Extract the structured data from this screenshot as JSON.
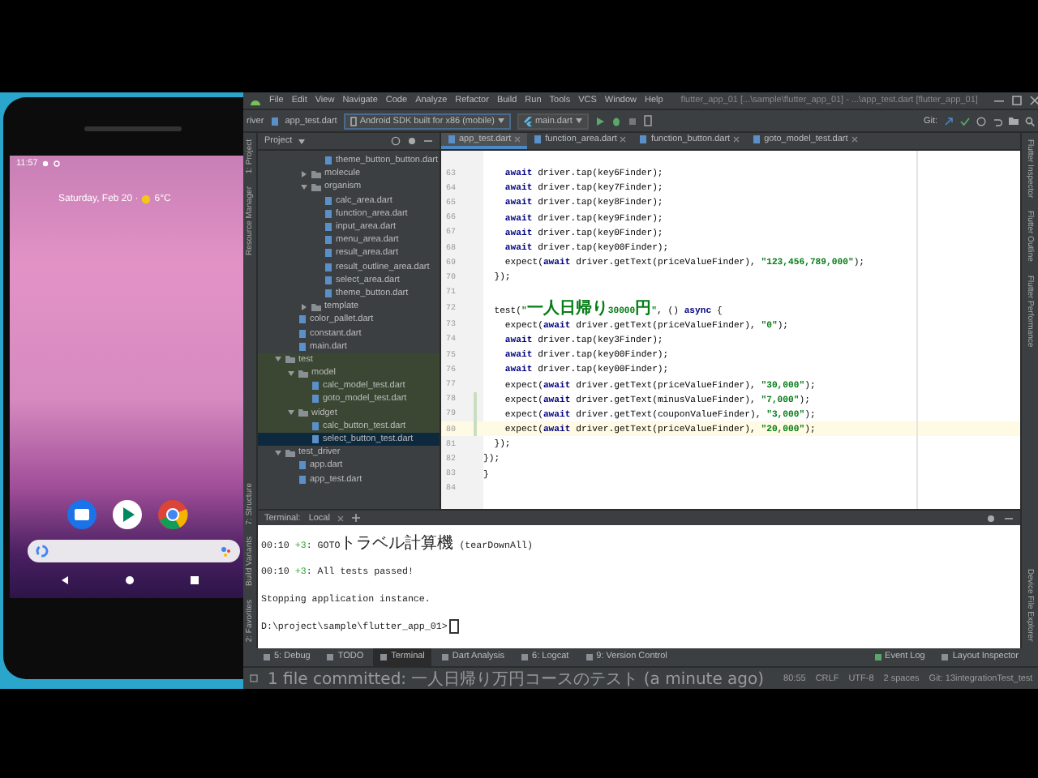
{
  "phone": {
    "time": "11:57",
    "date": "Saturday, Feb 20 ·",
    "temperature": "6°C"
  },
  "ide": {
    "menu": [
      "File",
      "Edit",
      "View",
      "Navigate",
      "Code",
      "Analyze",
      "Refactor",
      "Build",
      "Run",
      "Tools",
      "VCS",
      "Window",
      "Help"
    ],
    "title": "flutter_app_01 [...\\sample\\flutter_app_01] - ...\\app_test.dart [flutter_app_01]",
    "breadcrumbs": [
      "river",
      "app_test.dart"
    ],
    "device": "Android SDK built for x86 (mobile)",
    "run_config": "main.dart",
    "vcs_label": "Git:",
    "project_header": "Project",
    "left_stripe_top": [
      "1: Project",
      "Resource Manager"
    ],
    "left_stripe_bottom": [
      "7: Structure",
      "Build Variants",
      "2: Favorites"
    ],
    "right_stripe_top": [
      "Flutter Inspector",
      "Flutter Outline",
      "Flutter Performance"
    ],
    "right_stripe_bottom": [
      "Device File Explorer"
    ],
    "tabs": [
      {
        "label": "app_test.dart",
        "selected": true
      },
      {
        "label": "function_area.dart",
        "selected": false
      },
      {
        "label": "function_button.dart",
        "selected": false
      },
      {
        "label": "goto_model_test.dart",
        "selected": false
      }
    ],
    "tree": [
      {
        "children": [
          {
            "children": [
              {
                "children": [
                  {
                    "label": "theme_button_button.dart",
                    "kind": "file",
                    "selected": false
                  }
                ]
              },
              {
                "label": "molecule",
                "kind": "folder",
                "expanded": false,
                "selected": false
              },
              {
                "label": "organism",
                "kind": "folder",
                "expanded": true,
                "selected": false,
                "children": [
                  {
                    "label": "calc_area.dart",
                    "kind": "file",
                    "selected": false
                  },
                  {
                    "label": "function_area.dart",
                    "kind": "file",
                    "selected": false
                  },
                  {
                    "label": "input_area.dart",
                    "kind": "file",
                    "selected": false
                  },
                  {
                    "label": "menu_area.dart",
                    "kind": "file",
                    "selected": false
                  },
                  {
                    "label": "result_area.dart",
                    "kind": "file",
                    "selected": false
                  },
                  {
                    "label": "result_outline_area.dart",
                    "kind": "file",
                    "selected": false
                  },
                  {
                    "label": "select_area.dart",
                    "kind": "file",
                    "selected": false
                  },
                  {
                    "label": "theme_button.dart",
                    "kind": "file",
                    "selected": false
                  }
                ]
              },
              {
                "label": "template",
                "kind": "folder",
                "expanded": false,
                "selected": false
              }
            ]
          },
          {
            "label": "color_pallet.dart",
            "kind": "file",
            "selected": false
          },
          {
            "label": "constant.dart",
            "kind": "file",
            "selected": false
          },
          {
            "label": "main.dart",
            "kind": "file",
            "selected": false
          }
        ]
      },
      {
        "label": "test",
        "kind": "folder",
        "expanded": true,
        "selected": false,
        "highlighted": true,
        "children": [
          {
            "label": "model",
            "kind": "folder",
            "expanded": true,
            "selected": false,
            "children": [
              {
                "label": "calc_model_test.dart",
                "kind": "file",
                "selected": false
              },
              {
                "label": "goto_model_test.dart",
                "kind": "file",
                "selected": false
              }
            ]
          },
          {
            "label": "widget",
            "kind": "folder",
            "expanded": true,
            "selected": false,
            "children": [
              {
                "label": "calc_button_test.dart",
                "kind": "file",
                "selected": false
              },
              {
                "label": "select_button_test.dart",
                "kind": "file",
                "selected": true
              }
            ]
          }
        ]
      },
      {
        "label": "test_driver",
        "kind": "folder",
        "expanded": true,
        "selected": false,
        "children": [
          {
            "label": "app.dart",
            "kind": "file",
            "selected": false
          },
          {
            "label": "app_test.dart",
            "kind": "file",
            "selected": false
          }
        ]
      }
    ],
    "code": [
      {
        "number": "63",
        "changed": false,
        "current": false,
        "segments": [
          {
            "kind": "kw",
            "text": "    await"
          },
          {
            "kind": "plain",
            "text": " driver.tap(key6Finder);"
          }
        ]
      },
      {
        "number": "64",
        "changed": false,
        "current": false,
        "segments": [
          {
            "kind": "kw",
            "text": "    await"
          },
          {
            "kind": "plain",
            "text": " driver.tap(key7Finder);"
          }
        ]
      },
      {
        "number": "65",
        "changed": false,
        "current": false,
        "segments": [
          {
            "kind": "kw",
            "text": "    await"
          },
          {
            "kind": "plain",
            "text": " driver.tap(key8Finder);"
          }
        ]
      },
      {
        "number": "66",
        "changed": false,
        "current": false,
        "segments": [
          {
            "kind": "kw",
            "text": "    await"
          },
          {
            "kind": "plain",
            "text": " driver.tap(key9Finder);"
          }
        ]
      },
      {
        "number": "67",
        "changed": false,
        "current": false,
        "segments": [
          {
            "kind": "kw",
            "text": "    await"
          },
          {
            "kind": "plain",
            "text": " driver.tap(key0Finder);"
          }
        ]
      },
      {
        "number": "68",
        "changed": false,
        "current": false,
        "segments": [
          {
            "kind": "kw",
            "text": "    await"
          },
          {
            "kind": "plain",
            "text": " driver.tap(key00Finder);"
          }
        ]
      },
      {
        "number": "69",
        "changed": false,
        "current": false,
        "segments": [
          {
            "kind": "plain",
            "text": "    expect("
          },
          {
            "kind": "kw",
            "text": "await"
          },
          {
            "kind": "plain",
            "text": " driver.getText(priceValueFinder), "
          },
          {
            "kind": "str",
            "text": "\"123,456,789,000\""
          },
          {
            "kind": "plain",
            "text": ");"
          }
        ]
      },
      {
        "number": "70",
        "changed": false,
        "current": false,
        "segments": [
          {
            "kind": "plain",
            "text": "  });"
          }
        ]
      },
      {
        "number": "71",
        "changed": false,
        "current": false
      },
      {
        "number": "72",
        "changed": false,
        "current": false,
        "segments": [
          {
            "kind": "plain",
            "text": "  test("
          },
          {
            "kind": "str",
            "text": "\"一人日帰り30000円\""
          },
          {
            "kind": "plain",
            "text": ", () "
          },
          {
            "kind": "kw",
            "text": "async"
          },
          {
            "kind": "plain",
            "text": " {"
          }
        ]
      },
      {
        "number": "73",
        "changed": false,
        "current": false,
        "segments": [
          {
            "kind": "plain",
            "text": "    expect("
          },
          {
            "kind": "kw",
            "text": "await"
          },
          {
            "kind": "plain",
            "text": " driver.getText(priceValueFinder), "
          },
          {
            "kind": "str",
            "text": "\"0\""
          },
          {
            "kind": "plain",
            "text": ");"
          }
        ]
      },
      {
        "number": "74",
        "changed": false,
        "current": false,
        "segments": [
          {
            "kind": "kw",
            "text": "    await"
          },
          {
            "kind": "plain",
            "text": " driver.tap(key3Finder);"
          }
        ]
      },
      {
        "number": "75",
        "changed": false,
        "current": false,
        "segments": [
          {
            "kind": "kw",
            "text": "    await"
          },
          {
            "kind": "plain",
            "text": " driver.tap(key00Finder);"
          }
        ]
      },
      {
        "number": "76",
        "changed": false,
        "current": false,
        "segments": [
          {
            "kind": "kw",
            "text": "    await"
          },
          {
            "kind": "plain",
            "text": " driver.tap(key00Finder);"
          }
        ]
      },
      {
        "number": "77",
        "changed": false,
        "current": false,
        "segments": [
          {
            "kind": "plain",
            "text": "    expect("
          },
          {
            "kind": "kw",
            "text": "await"
          },
          {
            "kind": "plain",
            "text": " driver.getText(priceValueFinder), "
          },
          {
            "kind": "str",
            "text": "\"30,000\""
          },
          {
            "kind": "plain",
            "text": ");"
          }
        ]
      },
      {
        "number": "78",
        "changed": true,
        "current": false,
        "segments": [
          {
            "kind": "plain",
            "text": "    expect("
          },
          {
            "kind": "kw",
            "text": "await"
          },
          {
            "kind": "plain",
            "text": " driver.getText(minusValueFinder), "
          },
          {
            "kind": "str",
            "text": "\"7,000\""
          },
          {
            "kind": "plain",
            "text": ");"
          }
        ]
      },
      {
        "number": "79",
        "changed": true,
        "current": false,
        "segments": [
          {
            "kind": "plain",
            "text": "    expect("
          },
          {
            "kind": "kw",
            "text": "await"
          },
          {
            "kind": "plain",
            "text": " driver.getText(couponValueFinder), "
          },
          {
            "kind": "str",
            "text": "\"3,000\""
          },
          {
            "kind": "plain",
            "text": ");"
          }
        ]
      },
      {
        "number": "80",
        "changed": true,
        "current": true,
        "segments": [
          {
            "kind": "plain",
            "text": "    expect("
          },
          {
            "kind": "kw",
            "text": "await"
          },
          {
            "kind": "plain",
            "text": " driver.getText(priceValueFinder), "
          },
          {
            "kind": "str",
            "text": "\"20,000\""
          },
          {
            "kind": "plain",
            "text": ");"
          }
        ]
      },
      {
        "number": "81",
        "changed": false,
        "current": false,
        "segments": [
          {
            "kind": "plain",
            "text": "  });"
          }
        ]
      },
      {
        "number": "82",
        "changed": false,
        "current": false,
        "segments": [
          {
            "kind": "plain",
            "text": "});"
          }
        ]
      },
      {
        "number": "83",
        "changed": false,
        "current": false,
        "segments": [
          {
            "kind": "plain",
            "text": "}"
          }
        ]
      },
      {
        "number": "84",
        "changed": false,
        "current": false
      }
    ],
    "terminal": {
      "title": "Terminal:",
      "session": "Local",
      "lines": [
        {
          "segments": [
            {
              "kind": "plain",
              "text": "00:10 "
            },
            {
              "kind": "count",
              "text": "+3"
            },
            {
              "kind": "plain",
              "text": ": GOTOトラベル計算機 (tearDownAll)"
            }
          ]
        },
        {
          "segments": [
            {
              "kind": "plain",
              "text": "00:10 "
            },
            {
              "kind": "count",
              "text": "+3"
            },
            {
              "kind": "plain",
              "text": ": All tests passed!"
            }
          ]
        },
        {
          "segments": [
            {
              "kind": "plain",
              "text": "Stopping application instance."
            }
          ]
        },
        {
          "cursor": true,
          "segments": [
            {
              "kind": "plain",
              "text": "D:\\project\\sample\\flutter_app_01>"
            }
          ]
        }
      ]
    },
    "tool_tabs": [
      {
        "label": "5: Debug",
        "selected": false
      },
      {
        "label": "TODO",
        "selected": false
      },
      {
        "label": "Terminal",
        "selected": true
      },
      {
        "label": "Dart Analysis",
        "selected": false
      },
      {
        "label": "6: Logcat",
        "selected": false
      },
      {
        "label": "9: Version Control",
        "selected": false
      }
    ],
    "right_tool_tabs": [
      "Event Log",
      "Layout Inspector"
    ],
    "status": {
      "message": "1 file committed: 一人日帰り万円コースのテスト (a minute ago)",
      "items": [
        "80:55",
        "CRLF",
        "UTF-8",
        "2 spaces",
        "Git: 13integrationTest_test"
      ]
    }
  }
}
